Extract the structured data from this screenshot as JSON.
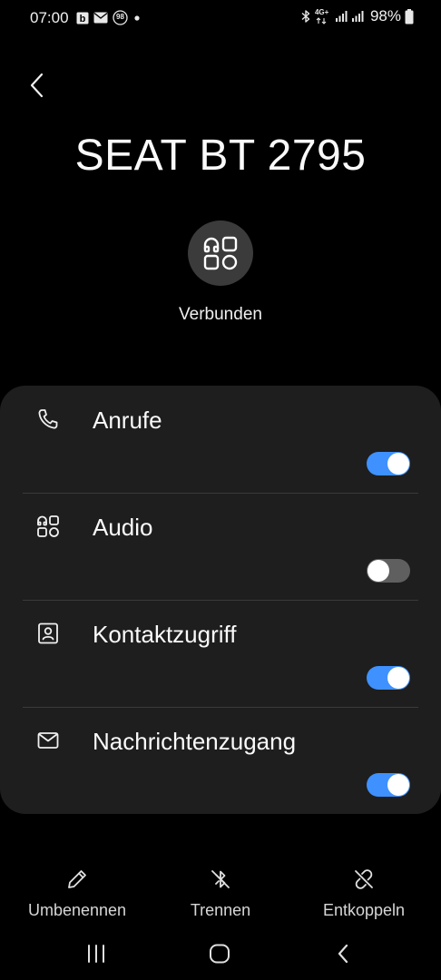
{
  "status_bar": {
    "time": "07:00",
    "battery": "98%",
    "network": "4G+",
    "notification_icons": [
      "b-app-icon",
      "mail-icon",
      "badge-98-icon",
      "dot-icon"
    ],
    "badge_text": "98"
  },
  "header": {
    "device_name": "SEAT BT 2795",
    "status": "Verbunden"
  },
  "profiles": [
    {
      "label": "Anrufe",
      "icon": "phone-icon",
      "enabled": true
    },
    {
      "label": "Audio",
      "icon": "apps-icon",
      "enabled": false
    },
    {
      "label": "Kontaktzugriff",
      "icon": "contact-card-icon",
      "enabled": true
    },
    {
      "label": "Nachrichtenzugang",
      "icon": "envelope-icon",
      "enabled": true
    }
  ],
  "actions": {
    "rename": "Umbenennen",
    "disconnect": "Trennen",
    "unpair": "Entkoppeln"
  },
  "colors": {
    "background": "#000000",
    "card": "#1e1e1e",
    "toggle_on": "#3e91ff",
    "toggle_off": "#5f5f5f",
    "icon_circle": "#3b3b3b"
  }
}
